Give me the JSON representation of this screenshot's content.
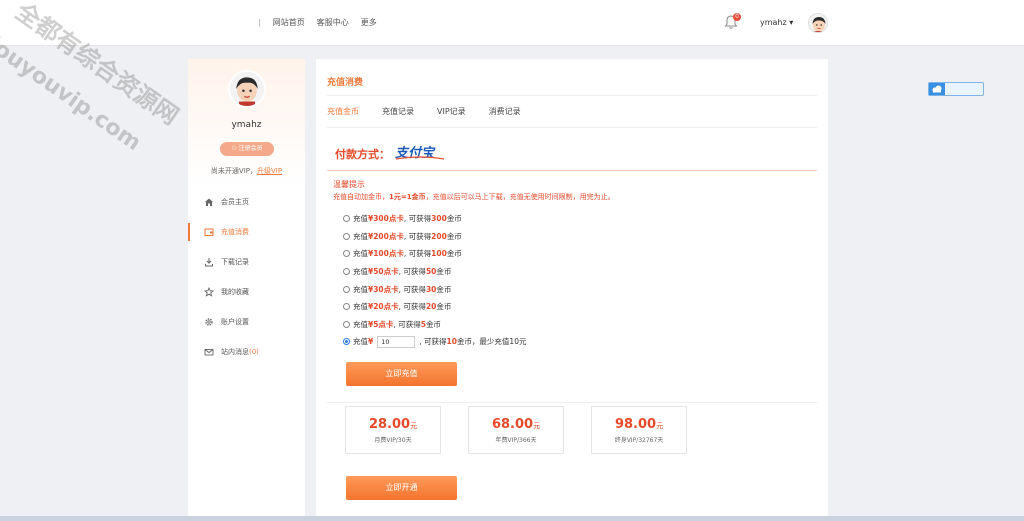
{
  "header": {
    "separator": "|",
    "nav": [
      "网站首页",
      "客服中心",
      "更多"
    ],
    "notification_count": "0",
    "username": "ymahz",
    "username_caret": "▾"
  },
  "watermark": {
    "line1": "全都有综合资源网",
    "line2": "douyouvip.com"
  },
  "sidebar": {
    "username": "ymahz",
    "register_badge": "注册会员",
    "vip_prefix": "尚未开通VIP，",
    "vip_upgrade": "升级VIP",
    "menu": [
      {
        "label": "会员主页",
        "icon": "home-icon"
      },
      {
        "label": "充值消费",
        "icon": "wallet-icon"
      },
      {
        "label": "下载记录",
        "icon": "download-icon"
      },
      {
        "label": "我的收藏",
        "icon": "star-icon"
      },
      {
        "label": "账户设置",
        "icon": "gear-icon"
      },
      {
        "label": "站内消息",
        "icon": "mail-icon",
        "count": "(0)"
      }
    ],
    "active_index": 1
  },
  "main": {
    "title": "充值消费",
    "tabs": [
      "充值金币",
      "充值记录",
      "VIP记录",
      "消费记录"
    ],
    "active_tab": 0,
    "pay_method_label": "付款方式：",
    "pay_logo_text": "支付宝",
    "tips_title": "温馨提示",
    "tips_prefix": "充值自动加金币，",
    "tips_rate": "1元=1金币",
    "tips_suffix": "，充值以后可以马上下载，充值无使用时间限制，用完为止。",
    "options": [
      {
        "pre": "充值 ",
        "card": "¥300点卡",
        "mid": ", 可获得 ",
        "coins": "300",
        "post": " 金币"
      },
      {
        "pre": "充值 ",
        "card": "¥200点卡",
        "mid": ", 可获得 ",
        "coins": "200",
        "post": " 金币"
      },
      {
        "pre": "充值 ",
        "card": "¥100点卡",
        "mid": ", 可获得 ",
        "coins": "100",
        "post": " 金币"
      },
      {
        "pre": "充值 ",
        "card": "¥50点卡",
        "mid": ", 可获得 ",
        "coins": "50",
        "post": " 金币"
      },
      {
        "pre": "充值 ",
        "card": "¥30点卡",
        "mid": ", 可获得 ",
        "coins": "30",
        "post": " 金币"
      },
      {
        "pre": "充值 ",
        "card": "¥20点卡",
        "mid": ", 可获得 ",
        "coins": "20",
        "post": " 金币"
      },
      {
        "pre": "充值 ",
        "card": "¥5点卡",
        "mid": ", 可获得 ",
        "coins": "5",
        "post": " 金币"
      }
    ],
    "custom_option": {
      "pre": "充值 ",
      "currency": "¥",
      "amount_value": "10",
      "mid": ", 可获得 ",
      "coins": "10",
      "post": " 金币，最少充值10元"
    },
    "pay_button": "立即充值",
    "vip_plans": [
      {
        "price": "28.00",
        "unit": "元",
        "label": "月费VIP/30天"
      },
      {
        "price": "68.00",
        "unit": "元",
        "label": "年费VIP/366天"
      },
      {
        "price": "98.00",
        "unit": "元",
        "label": "终身VIP/32767天"
      }
    ],
    "open_button": "立即开通"
  },
  "colors": {
    "accent": "#f07a3b",
    "price_red": "#e64a2b",
    "radio_blue": "#2a7ce8"
  }
}
